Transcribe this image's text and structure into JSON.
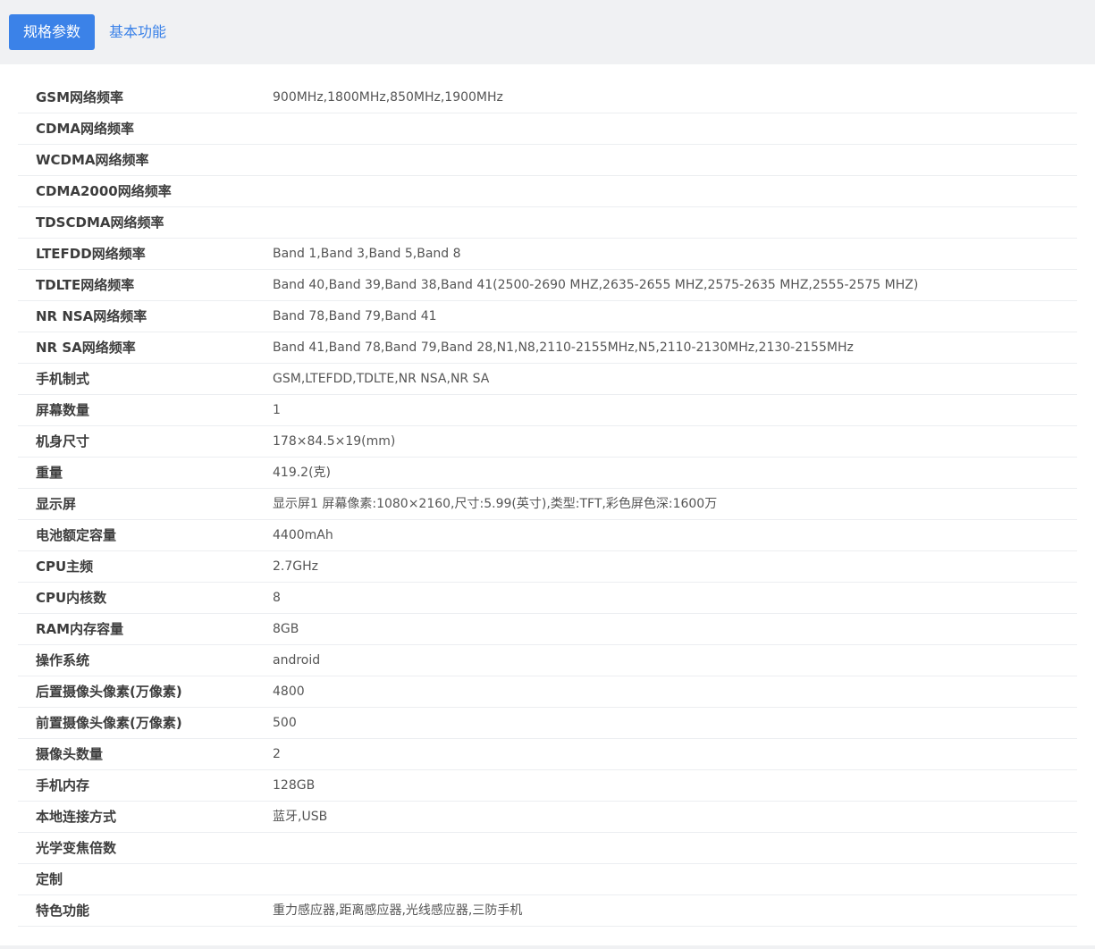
{
  "tabs": [
    {
      "label": "规格参数",
      "active": true
    },
    {
      "label": "基本功能",
      "active": false
    }
  ],
  "colors": {
    "accent": "#3b82e8",
    "tabbar_bg": "#f0f1f3",
    "row_divider": "#eceef1"
  },
  "specs": [
    {
      "name": "GSM网络频率",
      "value": "900MHz,1800MHz,850MHz,1900MHz"
    },
    {
      "name": "CDMA网络频率",
      "value": ""
    },
    {
      "name": "WCDMA网络频率",
      "value": ""
    },
    {
      "name": "CDMA2000网络频率",
      "value": ""
    },
    {
      "name": "TDSCDMA网络频率",
      "value": ""
    },
    {
      "name": "LTEFDD网络频率",
      "value": "Band 1,Band 3,Band 5,Band 8"
    },
    {
      "name": "TDLTE网络频率",
      "value": "Band 40,Band 39,Band 38,Band 41(2500-2690 MHZ,2635-2655 MHZ,2575-2635 MHZ,2555-2575 MHZ)"
    },
    {
      "name": "NR NSA网络频率",
      "value": "Band 78,Band 79,Band 41"
    },
    {
      "name": "NR SA网络频率",
      "value": "Band 41,Band 78,Band 79,Band 28,N1,N8,2110-2155MHz,N5,2110-2130MHz,2130-2155MHz"
    },
    {
      "name": "手机制式",
      "value": "GSM,LTEFDD,TDLTE,NR NSA,NR SA"
    },
    {
      "name": "屏幕数量",
      "value": "1"
    },
    {
      "name": "机身尺寸",
      "value": "178×84.5×19(mm)"
    },
    {
      "name": "重量",
      "value": "419.2(克)"
    },
    {
      "name": "显示屏",
      "value": "显示屏1 屏幕像素:1080×2160,尺寸:5.99(英寸),类型:TFT,彩色屏色深:1600万"
    },
    {
      "name": "电池额定容量",
      "value": "4400mAh"
    },
    {
      "name": "CPU主频",
      "value": "2.7GHz"
    },
    {
      "name": "CPU内核数",
      "value": "8"
    },
    {
      "name": "RAM内存容量",
      "value": "8GB"
    },
    {
      "name": "操作系统",
      "value": "android"
    },
    {
      "name": "后置摄像头像素(万像素)",
      "value": "4800"
    },
    {
      "name": "前置摄像头像素(万像素)",
      "value": "500"
    },
    {
      "name": "摄像头数量",
      "value": "2"
    },
    {
      "name": "手机内存",
      "value": "128GB"
    },
    {
      "name": "本地连接方式",
      "value": "蓝牙,USB"
    },
    {
      "name": "光学变焦倍数",
      "value": ""
    },
    {
      "name": "定制",
      "value": ""
    },
    {
      "name": "特色功能",
      "value": "重力感应器,距离感应器,光线感应器,三防手机"
    }
  ]
}
